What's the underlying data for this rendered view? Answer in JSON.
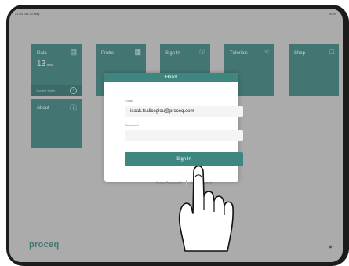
{
  "status_bar": {
    "time": "21:55  Sat 23 May",
    "battery": "90%"
  },
  "tiles": [
    {
      "label": "Data",
      "icon": "bar-chart-icon",
      "count": "13",
      "count_unit": "files",
      "sub_label": "Current folder"
    },
    {
      "label": "Probe",
      "icon": "calculator-icon"
    },
    {
      "label": "Sign In",
      "icon": "user-icon"
    },
    {
      "label": "Tutorials",
      "icon": "hand-pointer-icon"
    },
    {
      "label": "Shop",
      "icon": "cart-icon"
    },
    {
      "label": "About",
      "icon": "info-icon"
    }
  ],
  "brand": {
    "logo_text": "proceq",
    "accent": "#3f8681"
  },
  "dialog": {
    "title": "Hello!",
    "email_label": "Email",
    "email_value": "isaak.tsalicoglou@proceq.com",
    "password_label": "Password",
    "password_value": "",
    "sign_in_label": "Sign In",
    "forgot_password_label": "Forgot Password?",
    "create_account_label": "Create Account"
  }
}
